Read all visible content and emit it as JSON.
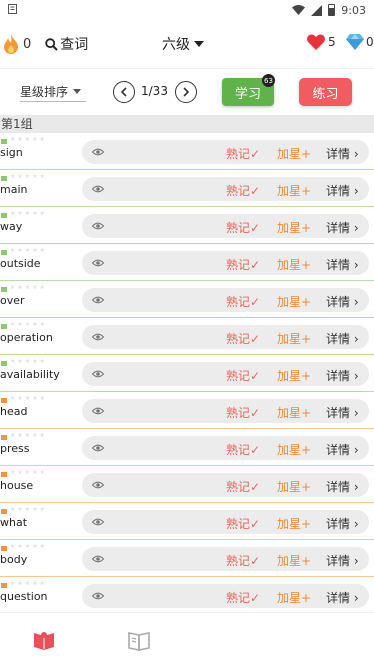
{
  "status_bar": {
    "time": "9:03"
  },
  "header": {
    "streak_count": "0",
    "search_label": "查词",
    "level": "六级",
    "hearts": "5",
    "diamonds": "0"
  },
  "controls": {
    "sort_label": "星级排序",
    "page": "1/33",
    "learn_label": "学习",
    "learn_badge": "63",
    "practice_label": "练习"
  },
  "group": {
    "title": "第1组"
  },
  "row_actions": {
    "known": "熟记✓",
    "star": "加星+",
    "detail": "详情 ›"
  },
  "words": [
    {
      "word": "sign",
      "status": "green"
    },
    {
      "word": "main",
      "status": "green"
    },
    {
      "word": "way",
      "status": "green"
    },
    {
      "word": "outside",
      "status": "green"
    },
    {
      "word": "over",
      "status": "green"
    },
    {
      "word": "operation",
      "status": "green"
    },
    {
      "word": "availability",
      "status": "green"
    },
    {
      "word": "head",
      "status": "orange"
    },
    {
      "word": "press",
      "status": "orange"
    },
    {
      "word": "house",
      "status": "orange"
    },
    {
      "word": "what",
      "status": "orange"
    },
    {
      "word": "body",
      "status": "orange"
    },
    {
      "word": "question",
      "status": "orange"
    }
  ],
  "colors": {
    "green_marker": "#8cc873",
    "orange_marker": "#f0934a",
    "green_separator": "#b8dba9",
    "orange_separator": "#f5c79e",
    "learn_button": "#5fb34a",
    "practice_button": "#f05d61"
  },
  "icons": {
    "streak": "flame-icon",
    "search": "search-icon",
    "heart": "heart-icon",
    "diamond": "diamond-icon",
    "eye": "eye-icon",
    "nav_learn": "open-book-icon",
    "nav_book": "book-icon"
  }
}
